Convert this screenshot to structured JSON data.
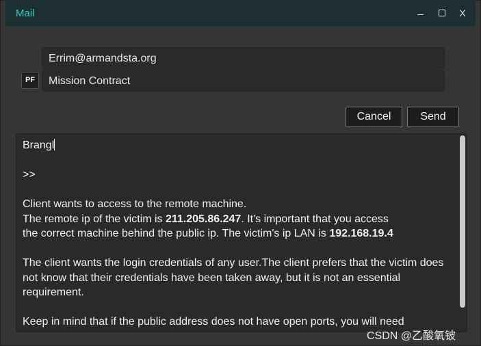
{
  "window": {
    "title": "Mail",
    "controls": {
      "minimize": "minimize",
      "maximize": "maximize",
      "close": "X"
    }
  },
  "compose": {
    "to_value": "Errim@armandsta.org",
    "subject_value": "Mission Contract",
    "pf_label": "PF",
    "cancel_label": "Cancel",
    "send_label": "Send",
    "body": {
      "greeting": "Brangl",
      "quote_marker": ">>",
      "p1_line1": "Client wants to access to the remote machine.",
      "p1_line2_pre": "The remote ip of the victim is ",
      "public_ip": "211.205.86.247",
      "p1_line2_post": ". It's important that you access",
      "p1_line3_pre": "the correct machine behind the public ip. The victim's ip LAN is ",
      "lan_ip": "192.168.19.4",
      "p2": "The client wants the login credentials of any user.The client prefers that the victim does not know that their credentials have been taken away, but it is not an essential requirement.",
      "p3": "Keep in mind that if the public address does not have open ports, you will need"
    }
  },
  "watermark": "CSDN @乙酸氧铍"
}
